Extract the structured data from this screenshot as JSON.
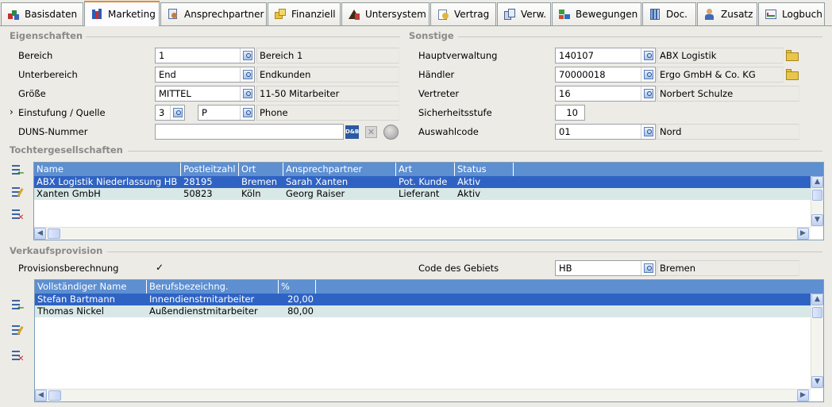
{
  "tabs": [
    {
      "label": "Basisdaten",
      "icon": "basisdaten-icon",
      "active": false
    },
    {
      "label": "Marketing",
      "icon": "marketing-icon",
      "active": true
    },
    {
      "label": "Ansprechpartner",
      "icon": "ansprechpartner-icon",
      "active": false
    },
    {
      "label": "Finanziell",
      "icon": "finanziell-icon",
      "active": false
    },
    {
      "label": "Untersystem",
      "icon": "untersystem-icon",
      "active": false
    },
    {
      "label": "Vertrag",
      "icon": "vertrag-icon",
      "active": false
    },
    {
      "label": "Verw.",
      "icon": "verw-icon",
      "active": false
    },
    {
      "label": "Bewegungen",
      "icon": "bewegungen-icon",
      "active": false
    },
    {
      "label": "Doc.",
      "icon": "doc-icon",
      "active": false
    },
    {
      "label": "Zusatz",
      "icon": "zusatz-icon",
      "active": false
    },
    {
      "label": "Logbuch",
      "icon": "logbuch-icon",
      "active": false
    }
  ],
  "eigenschaften": {
    "title": "Eigenschaften",
    "bereich": {
      "label": "Bereich",
      "value": "1",
      "desc": "Bereich 1"
    },
    "unterbereich": {
      "label": "Unterbereich",
      "value": "End",
      "desc": "Endkunden"
    },
    "groesse": {
      "label": "Größe",
      "value": "MITTEL",
      "desc": "11-50 Mitarbeiter"
    },
    "einstufung": {
      "label": "Einstufung / Quelle",
      "value1": "3",
      "value2": "P",
      "desc": "Phone"
    },
    "duns": {
      "label": "DUNS-Nummer",
      "value": "",
      "badge": "D&B"
    }
  },
  "sonstige": {
    "title": "Sonstige",
    "hauptverwaltung": {
      "label": "Hauptverwaltung",
      "value": "140107",
      "desc": "ABX Logistik"
    },
    "haendler": {
      "label": "Händler",
      "value": "70000018",
      "desc": "Ergo GmbH & Co. KG"
    },
    "vertreter": {
      "label": "Vertreter",
      "value": "16",
      "desc": "Norbert Schulze"
    },
    "sicherheitsstufe": {
      "label": "Sicherheitsstufe",
      "value": "10"
    },
    "auswahlcode": {
      "label": "Auswahlcode",
      "value": "01",
      "desc": "Nord"
    }
  },
  "tochter": {
    "title": "Tochtergesellschaften",
    "columns": [
      "Name",
      "Postleitzahl",
      "Ort",
      "Ansprechpartner",
      "Art",
      "Status"
    ],
    "rows": [
      [
        "ABX Logistik Niederlassung HB",
        "28195",
        "Bremen",
        "Sarah Xanten",
        "Pot. Kunde",
        "Aktiv"
      ],
      [
        "Xanten GmbH",
        "50823",
        "Köln",
        "Georg Raiser",
        "Lieferant",
        "Aktiv"
      ]
    ]
  },
  "verkauf": {
    "title": "Verkaufsprovision",
    "provision": {
      "label": "Provisionsberechnung",
      "checked": "✓"
    },
    "gebiet": {
      "label": "Code des Gebiets",
      "value": "HB",
      "desc": "Bremen"
    },
    "columns": [
      "Vollständiger Name",
      "Berufsbezeichng.",
      "%"
    ],
    "rows": [
      [
        "Stefan Bartmann",
        "Innendienstmitarbeiter",
        "20,00"
      ],
      [
        "Thomas Nickel",
        "Außendienstmitarbeiter",
        "80,00"
      ]
    ]
  },
  "misc": {
    "arrow_marker": "›",
    "scroll_up": "▲",
    "scroll_down": "▼",
    "scroll_left": "◀",
    "scroll_right": "▶",
    "x_glyph": "✕"
  }
}
